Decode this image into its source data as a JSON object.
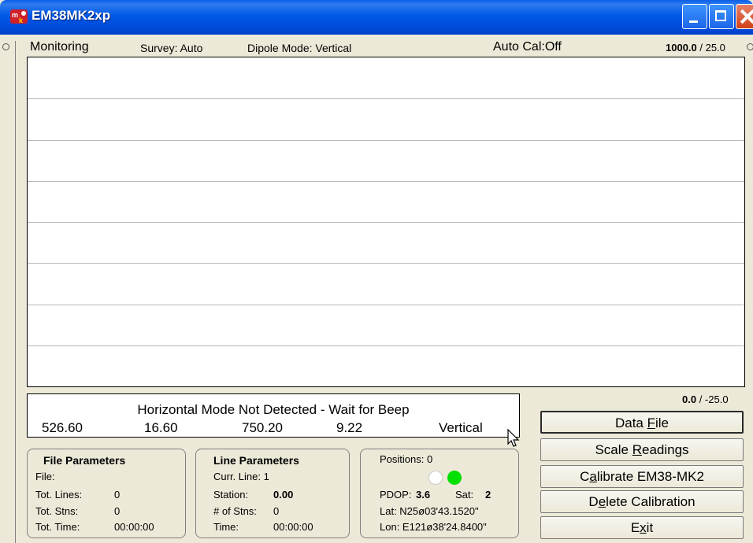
{
  "window": {
    "title": "EM38MK2xp",
    "icon": "em38-app-icon",
    "accent": "#0058E6"
  },
  "header": {
    "mode": "Monitoring",
    "survey": "Survey: Auto",
    "dipole": "Dipole Mode: Vertical",
    "autocal": "Auto Cal:Off",
    "scale_top_value": "1000.0",
    "scale_top_sep": " / 25.0"
  },
  "graph": {
    "gridlines": 8
  },
  "scale_bottom": {
    "value": "0.0",
    "sep": " / -25.0"
  },
  "readout": {
    "message": "Horizontal Mode Not Detected - Wait for Beep",
    "values": [
      "526.60",
      "16.60",
      "750.20",
      "9.22"
    ],
    "mode": "Vertical"
  },
  "buttons": {
    "data_file": {
      "pre": "Data ",
      "key": "F",
      "post": "ile"
    },
    "scale_readings": {
      "pre": "Scale ",
      "key": "R",
      "post": "eadings"
    },
    "calibrate": {
      "pre": "C",
      "key": "a",
      "post": "librate EM38-MK2"
    },
    "delete_calibration": {
      "pre": "D",
      "key": "e",
      "post": "lete Calibration"
    },
    "exit": {
      "pre": "E",
      "key": "x",
      "post": "it"
    }
  },
  "file_parameters": {
    "title": "File Parameters",
    "file_label": "File:",
    "file_value": "",
    "tot_lines_label": "Tot. Lines:",
    "tot_lines_value": "0",
    "tot_stns_label": "Tot. Stns:",
    "tot_stns_value": "0",
    "tot_time_label": "Tot. Time:",
    "tot_time_value": "00:00:00"
  },
  "line_parameters": {
    "title": "Line Parameters",
    "curr_line": "Curr. Line: 1",
    "station_label": "Station:",
    "station_value": "0.00",
    "num_stns_label": "# of Stns:",
    "num_stns_value": "0",
    "time_label": "Time:",
    "time_value": "00:00:00"
  },
  "gps": {
    "positions": "Positions: 0",
    "indicator_colors": [
      "#FFFFFF",
      "#00E000"
    ],
    "pdop_label": "PDOP:",
    "pdop_value": "3.6",
    "sat_label": "Sat:",
    "sat_value": "2",
    "lat": "Lat:  N25ø03'43.1520\"",
    "lon": "Lon: E121ø38'24.8400\""
  }
}
